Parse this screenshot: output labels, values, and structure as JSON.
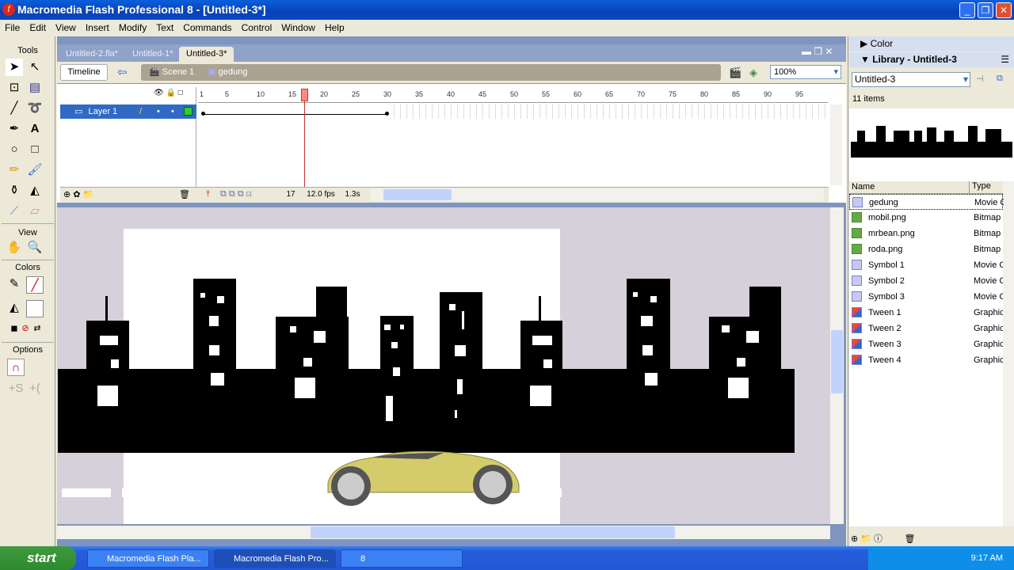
{
  "window": {
    "title": "Macromedia Flash Professional 8 - [Untitled-3*]"
  },
  "menu": [
    "File",
    "Edit",
    "View",
    "Insert",
    "Modify",
    "Text",
    "Commands",
    "Control",
    "Window",
    "Help"
  ],
  "tools": {
    "title": "Tools",
    "view": "View",
    "colors": "Colors",
    "options": "Options"
  },
  "tabs": [
    {
      "label": "Untitled-2.fla*"
    },
    {
      "label": "Untitled-1*"
    },
    {
      "label": "Untitled-3*",
      "active": true
    }
  ],
  "editbar": {
    "timeline": "Timeline",
    "scene": "Scene 1",
    "symbol": "gedung",
    "zoom": "100%"
  },
  "timeline": {
    "layer": "Layer 1",
    "ruler": [
      1,
      5,
      10,
      15,
      20,
      25,
      30,
      35,
      40,
      45,
      50,
      55,
      60,
      65,
      70,
      75,
      80,
      85,
      90,
      95
    ],
    "current_frame": "17",
    "fps": "12.0 fps",
    "time": "1.3s",
    "tween_start": 1,
    "tween_end": 30
  },
  "panels": {
    "color": "Color",
    "library": "Library - Untitled-3",
    "library_select": "Untitled-3",
    "count": "11 items",
    "col_name": "Name",
    "col_type": "Type"
  },
  "library": [
    {
      "name": "gedung",
      "type": "Movie Clip",
      "icon": "movie-clip"
    },
    {
      "name": "mobil.png",
      "type": "Bitmap",
      "icon": "bitmap"
    },
    {
      "name": "mrbean.png",
      "type": "Bitmap",
      "icon": "bitmap"
    },
    {
      "name": "roda.png",
      "type": "Bitmap",
      "icon": "bitmap"
    },
    {
      "name": "Symbol 1",
      "type": "Movie Clip",
      "icon": "movie-clip"
    },
    {
      "name": "Symbol 2",
      "type": "Movie Clip",
      "icon": "movie-clip"
    },
    {
      "name": "Symbol 3",
      "type": "Movie Clip",
      "icon": "movie-clip"
    },
    {
      "name": "Tween 1",
      "type": "Graphic",
      "icon": "graphic"
    },
    {
      "name": "Tween 2",
      "type": "Graphic",
      "icon": "graphic"
    },
    {
      "name": "Tween 3",
      "type": "Graphic",
      "icon": "graphic"
    },
    {
      "name": "Tween 4",
      "type": "Graphic",
      "icon": "graphic"
    }
  ],
  "taskbar": {
    "start": "start",
    "items": [
      "Macromedia Flash Pla...",
      "Macromedia Flash Pro...",
      "8"
    ],
    "clock": "9:17 AM"
  }
}
